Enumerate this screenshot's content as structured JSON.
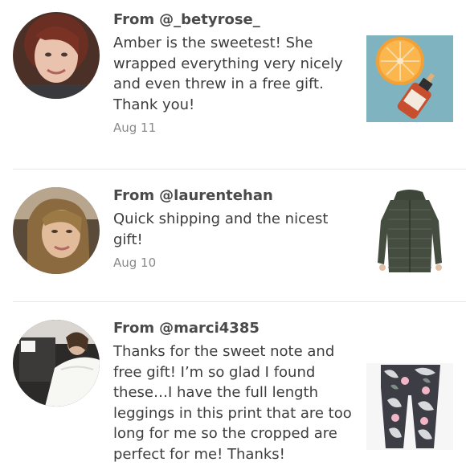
{
  "from_prefix": "From",
  "reviews": [
    {
      "username": "@_betyrose_",
      "text": "Amber is the sweetest! She wrapped everything very nicely and even threw in a free gift. Thank you!",
      "date": "Aug 11",
      "avatar_icon": "user-avatar-photo",
      "product_icon": "product-orange-serum-photo"
    },
    {
      "username": "@laurentehan",
      "text": "Quick shipping and the nicest gift!",
      "date": "Aug 10",
      "avatar_icon": "user-avatar-photo",
      "product_icon": "product-green-puffer-jacket-photo"
    },
    {
      "username": "@marci4385",
      "text": "Thanks for the sweet note and free gift! I’m so glad I found these…I have the full length leggings in this print that are too long for me so the cropped are perfect for me! Thanks!",
      "date": "",
      "avatar_icon": "user-avatar-photo",
      "product_icon": "product-floral-leggings-photo"
    }
  ]
}
